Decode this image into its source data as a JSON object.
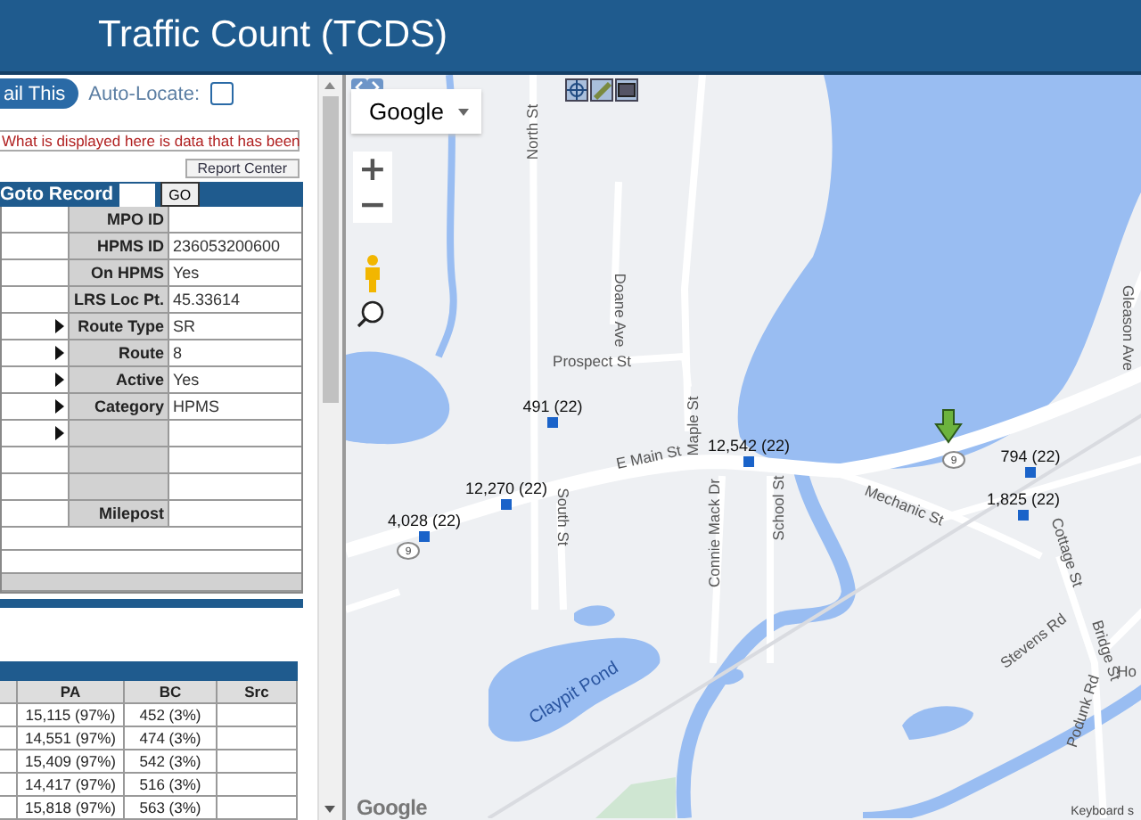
{
  "header": {
    "title": "Traffic Count (TCDS)"
  },
  "panel": {
    "email_button": "ail This",
    "auto_locate": {
      "label": "Auto-Locate:",
      "checked": false
    },
    "notice": "What is displayed here is data that has been",
    "report_button": "Report Center",
    "goto": {
      "label": "Goto Record",
      "button": "GO"
    },
    "details": [
      {
        "label": "MPO ID",
        "expandable": false
      },
      {
        "label": "HPMS ID",
        "value": "236053200600",
        "expandable": false
      },
      {
        "label": "On HPMS",
        "value": "Yes",
        "expandable": false
      },
      {
        "label": "LRS Loc Pt.",
        "value": "45.33614",
        "expandable": false
      },
      {
        "label": "Route Type",
        "value": "SR",
        "expandable": true
      },
      {
        "label": "Route",
        "value": "8",
        "expandable": true
      },
      {
        "label": "Active",
        "value": "Yes",
        "expandable": true
      },
      {
        "label": "Category",
        "value": "HPMS",
        "expandable": true
      },
      {
        "expandable": true
      },
      {
        "expandable": false
      },
      {
        "expandable": false
      },
      {
        "label": "Milepost",
        "expandable": false
      }
    ],
    "counts_table": {
      "columns": [
        "PA",
        "BC",
        "Src"
      ],
      "rows": [
        {
          "pa": "15,115 (97%)",
          "bc": "452 (3%)"
        },
        {
          "pa": "14,551 (97%)",
          "bc": "474 (3%)"
        },
        {
          "pa": "15,409 (97%)",
          "bc": "542 (3%)"
        },
        {
          "pa": "14,417 (97%)",
          "bc": "516 (3%)"
        },
        {
          "pa": "15,818 (97%)",
          "bc": "563 (3%)"
        }
      ]
    }
  },
  "map": {
    "provider": "Google",
    "zoom_in": "+",
    "zoom_out": "−",
    "street_labels": [
      "North St",
      "Doane Ave",
      "Prospect St",
      "Maple St",
      "E Main St",
      "South St",
      "Connie Mack Dr",
      "School St",
      "Mechanic St",
      "Cottage St",
      "Gleason Ave",
      "Stevens Rd",
      "Bridge St",
      "Podunk Rd",
      "Ho"
    ],
    "water_label": "Claypit Pond",
    "route_shields": [
      "9",
      "9"
    ],
    "count_markers": [
      {
        "label": "491 (22)"
      },
      {
        "label": "12,270 (22)"
      },
      {
        "label": "4,028 (22)"
      },
      {
        "label": "12,542 (22)"
      },
      {
        "label": "794 (22)"
      },
      {
        "label": "1,825 (22)"
      }
    ],
    "attribution": "Google",
    "keyboard_link": "Keyboard s"
  }
}
